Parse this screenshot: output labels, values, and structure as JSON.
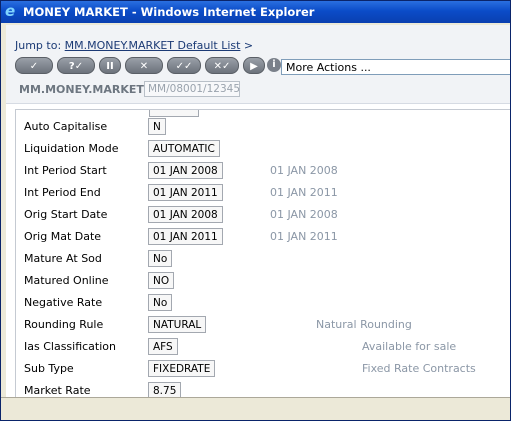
{
  "window": {
    "title": "MONEY MARKET - Windows Internet Explorer"
  },
  "nav": {
    "jump_prefix": "Jump to:",
    "jump_link": "MM.MONEY.MARKET Default List",
    "jump_suffix": ">"
  },
  "toolbar": {
    "buttons": [
      "✓",
      "?✓",
      "II",
      "✕",
      "✓✓",
      "✕✓",
      "▶"
    ],
    "info_icon": "i",
    "more_actions": "More Actions ..."
  },
  "record": {
    "app_label": "MM.MONEY.MARKET",
    "id_value": "MM/08001/12345"
  },
  "fields": [
    {
      "label": "Auto Capitalise",
      "value": "N",
      "extra": ""
    },
    {
      "label": "Liquidation Mode",
      "value": "AUTOMATIC",
      "extra": ""
    },
    {
      "label": "Int Period Start",
      "value": "01 JAN 2008",
      "extra": "01 JAN 2008"
    },
    {
      "label": "Int Period End",
      "value": "01 JAN 2011",
      "extra": "01 JAN 2011"
    },
    {
      "label": "Orig Start Date",
      "value": "01 JAN 2008",
      "extra": "01 JAN 2008"
    },
    {
      "label": "Orig Mat Date",
      "value": "01 JAN 2011",
      "extra": "01 JAN 2011"
    },
    {
      "label": "Mature At Sod",
      "value": "No",
      "extra": ""
    },
    {
      "label": "Matured Online",
      "value": "NO",
      "extra": ""
    },
    {
      "label": "Negative Rate",
      "value": "No",
      "extra": ""
    },
    {
      "label": "Rounding Rule",
      "value": "NATURAL",
      "extra": "Natural Rounding"
    },
    {
      "label": "Ias Classification",
      "value": "AFS",
      "extra": "Available for sale"
    },
    {
      "label": "Sub Type",
      "value": "FIXEDRATE",
      "extra": "Fixed Rate Contracts"
    },
    {
      "label": "Market Rate",
      "value": "8.75",
      "extra": ""
    }
  ],
  "colors": {
    "titlebar": "#0b4cc8",
    "link": "#1b3a75",
    "muted": "#8b97a6"
  }
}
